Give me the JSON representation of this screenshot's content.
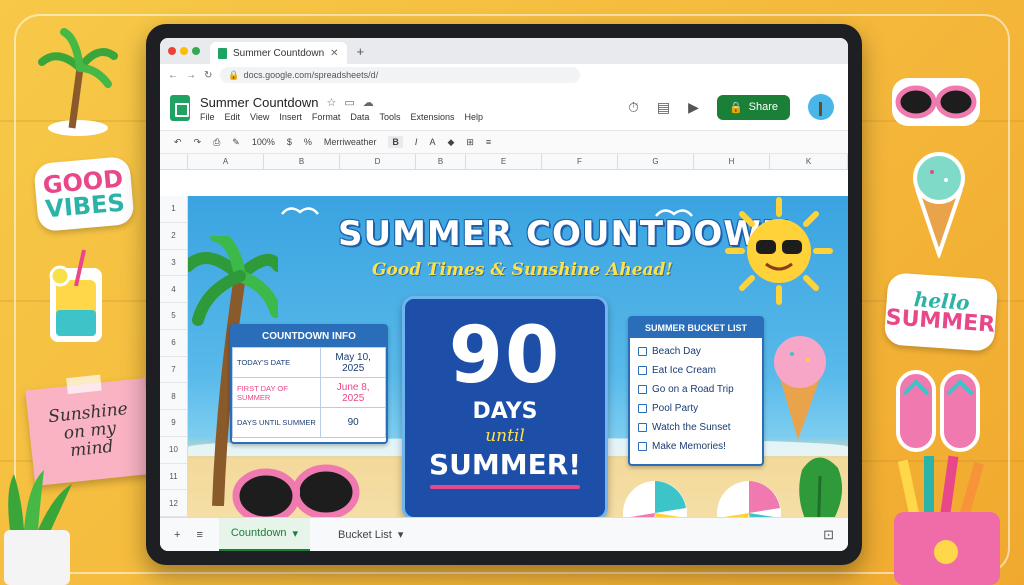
{
  "browser": {
    "tab_title": "Summer Countdown",
    "url": "docs.google.com/spreadsheets/d/"
  },
  "app": {
    "doc_title": "Summer Countdown",
    "menus": [
      "File",
      "Edit",
      "View",
      "Insert",
      "Format",
      "Data",
      "Tools",
      "Extensions",
      "Help"
    ],
    "share_label": "Share",
    "toolbar": {
      "zoom": "100%",
      "currency": "$",
      "percent": "%",
      "font_name": "Merriweather",
      "bold": "B",
      "italic": "I"
    }
  },
  "grid": {
    "columns": [
      "A",
      "B",
      "D",
      "B",
      "E",
      "F",
      "G",
      "H",
      "K"
    ],
    "rows": [
      "1",
      "2",
      "3",
      "4",
      "5",
      "6",
      "7",
      "8",
      "9",
      "10",
      "11",
      "12"
    ]
  },
  "banner": {
    "title": "SUMMER COUNTDOWN",
    "subtitle": "Good Times & Sunshine Ahead!"
  },
  "countdown_info": {
    "header": "COUNTDOWN INFO",
    "rows": [
      {
        "label": "TODAY'S DATE",
        "value": "May 10, 2025"
      },
      {
        "label": "FIRST DAY OF SUMMER",
        "value": "June 8, 2025"
      },
      {
        "label": "DAYS UNTIL SUMMER",
        "value": "90"
      }
    ]
  },
  "countdown": {
    "number": "90",
    "days": "DAYS",
    "until": "until",
    "summer": "SUMMER!"
  },
  "bucket_list": {
    "header": "SUMMER BUCKET LIST",
    "items": [
      "Beach Day",
      "Eat Ice Cream",
      "Go on a Road Trip",
      "Pool Party",
      "Watch the Sunset",
      "Make Memories!"
    ]
  },
  "sheet_tabs": {
    "tabs": [
      "Countdown",
      "Bucket List"
    ]
  },
  "stickers": {
    "good": "GOOD",
    "vibes": "VIBES",
    "hello": "hello",
    "summer": "SUMMER",
    "note_lines": [
      "Sunshine",
      "on my",
      "mind"
    ]
  },
  "colors": {
    "accent_green": "#1a7f37",
    "primary_blue": "#2a6db8",
    "pink": "#e8488a",
    "yellow": "#ffe14a"
  }
}
